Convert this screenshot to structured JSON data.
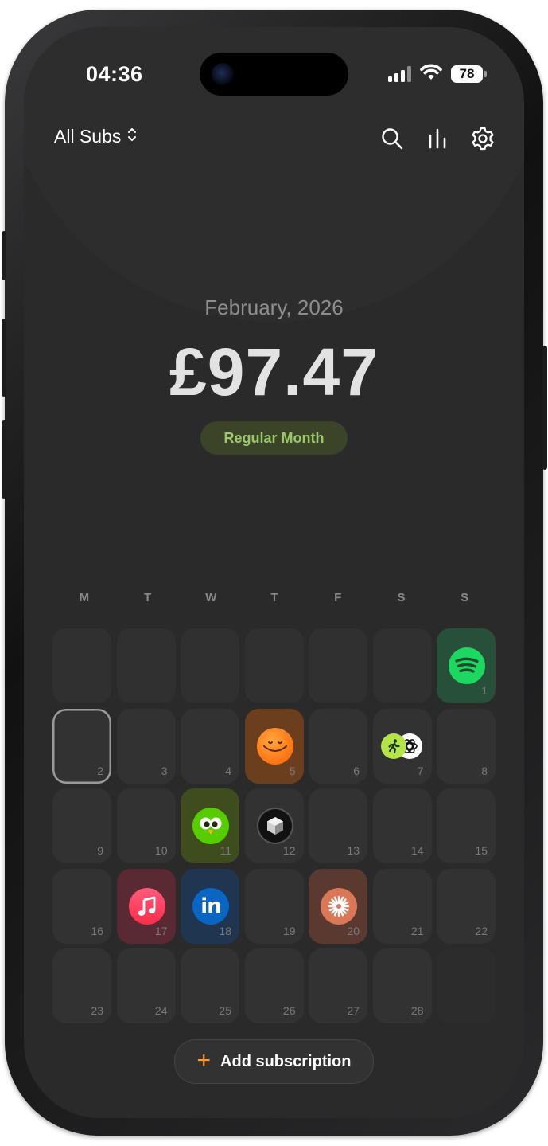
{
  "status_bar": {
    "time": "04:36",
    "battery": "78"
  },
  "header": {
    "filter_label": "All Subs"
  },
  "summary": {
    "month": "February, 2026",
    "total": "£97.47",
    "badge": "Regular Month"
  },
  "calendar": {
    "weekdays": [
      "M",
      "T",
      "W",
      "T",
      "F",
      "S",
      "S"
    ],
    "day_numbers": [
      "1",
      "2",
      "3",
      "4",
      "5",
      "6",
      "7",
      "8",
      "9",
      "10",
      "11",
      "12",
      "13",
      "14",
      "15",
      "16",
      "17",
      "18",
      "19",
      "20",
      "21",
      "22",
      "23",
      "24",
      "25",
      "26",
      "27",
      "28"
    ],
    "today": "2",
    "subscriptions": [
      {
        "day": "1",
        "icon": "spotify-icon",
        "tint": "#27503a",
        "color": "#1ed760"
      },
      {
        "day": "5",
        "icon": "headspace-icon",
        "tint": "#6b3f1d",
        "color": "#ff7a1a"
      },
      {
        "day": "7",
        "icon": "fitness-icon",
        "tint": "#323232",
        "color": "#b4e34a"
      },
      {
        "day": "7",
        "icon": "chatgpt-icon",
        "tint": "#323232",
        "color": "#ffffff"
      },
      {
        "day": "11",
        "icon": "duolingo-icon",
        "tint": "#3f4d1e",
        "color": "#58cc02"
      },
      {
        "day": "12",
        "icon": "cube-app-icon",
        "tint": "#323232",
        "color": "#111111"
      },
      {
        "day": "17",
        "icon": "apple-music-icon",
        "tint": "#5a2a34",
        "color": "#fa2d48"
      },
      {
        "day": "18",
        "icon": "linkedin-icon",
        "tint": "#1f3550",
        "color": "#0a66c2"
      },
      {
        "day": "20",
        "icon": "claude-icon",
        "tint": "#5a3a30",
        "color": "#d97757"
      }
    ]
  },
  "add_button": {
    "label": "Add subscription"
  },
  "colors": {
    "background": "#2a2a2a",
    "accent_orange": "#ff9a3d",
    "badge_green": "#9ac86a"
  }
}
